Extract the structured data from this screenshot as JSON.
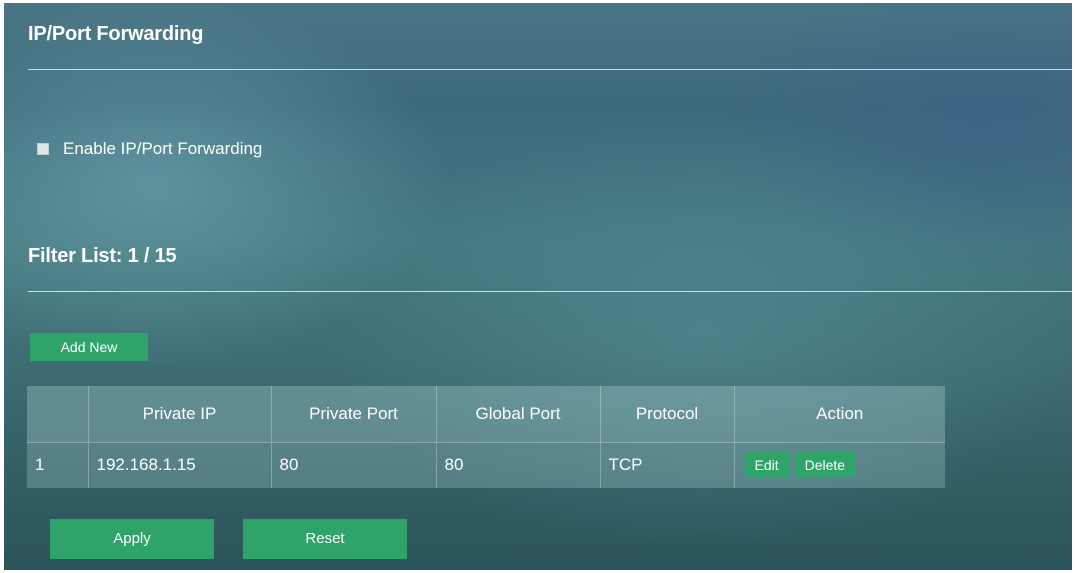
{
  "header": {
    "title": "IP/Port Forwarding"
  },
  "enable": {
    "label": "Enable IP/Port Forwarding",
    "checked": false
  },
  "filter_list": {
    "title": "Filter List: 1 / 15",
    "add_new_label": "Add New"
  },
  "table": {
    "columns": [
      "",
      "Private IP",
      "Private Port",
      "Global Port",
      "Protocol",
      "Action"
    ],
    "rows": [
      {
        "num": "1",
        "private_ip": "192.168.1.15",
        "private_port": "80",
        "global_port": "80",
        "protocol": "TCP",
        "edit_label": "Edit",
        "delete_label": "Delete"
      }
    ]
  },
  "footer": {
    "apply_label": "Apply",
    "reset_label": "Reset"
  },
  "colors": {
    "button_green": "#2ea36a",
    "background_teal": "#3f6e74"
  }
}
